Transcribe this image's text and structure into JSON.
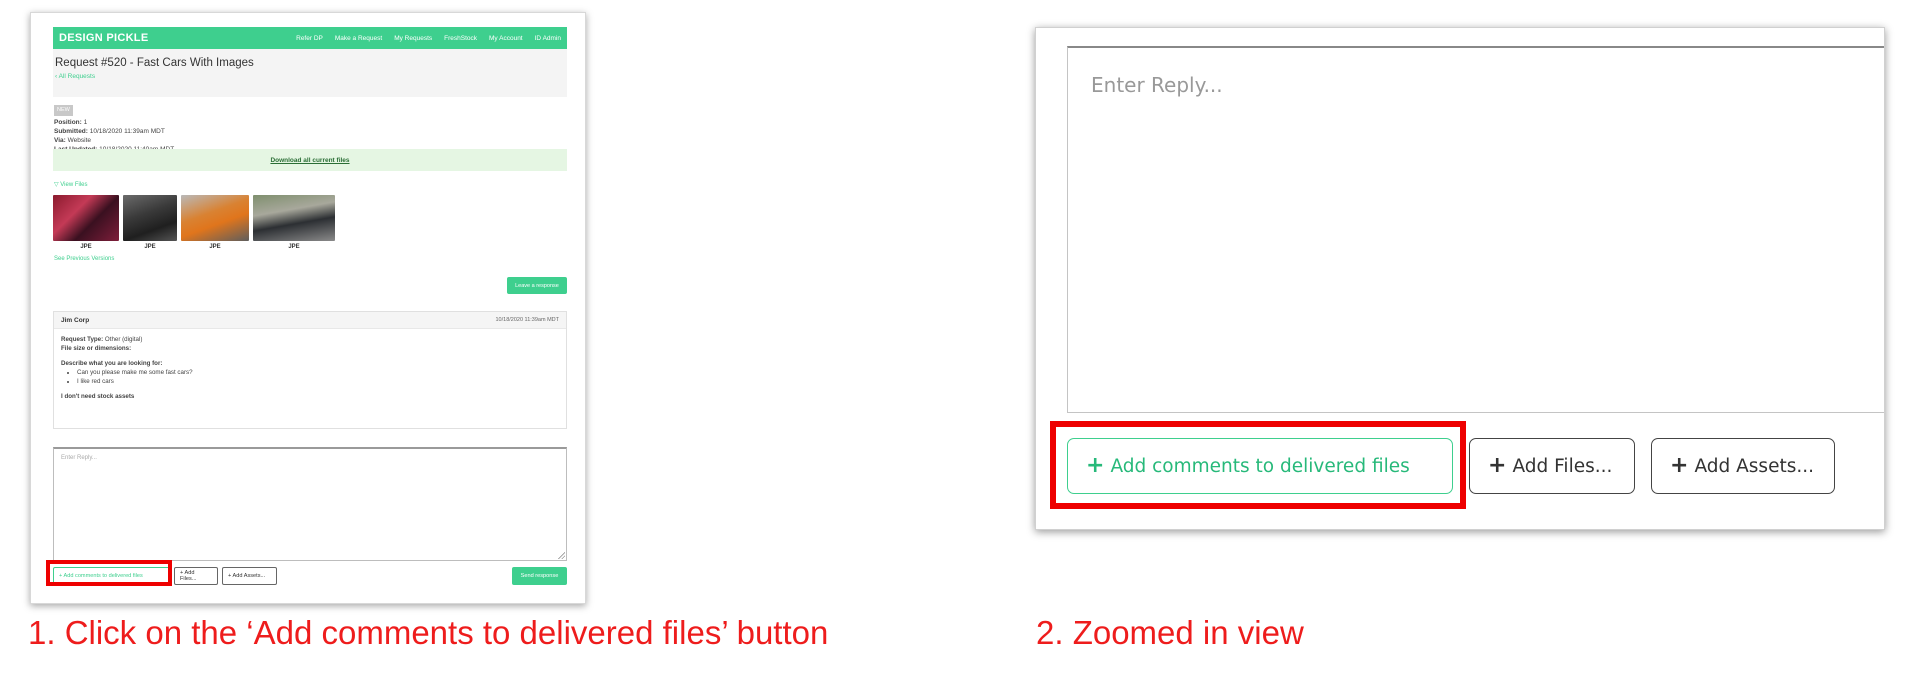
{
  "app": {
    "brand": "DESIGN PICKLE",
    "nav": [
      "Refer DP",
      "Make a Request",
      "My Requests",
      "FreshStock",
      "My Account",
      "ID Admin"
    ]
  },
  "request": {
    "title": "Request #520 - Fast Cars With Images",
    "back_link": "‹ All Requests",
    "status_chip": "NEW",
    "position_label": "Position:",
    "position_value": "1",
    "submitted_label": "Submitted:",
    "submitted_value": "10/18/2020 11:39am MDT",
    "via_label": "Via:",
    "via_value": "Website",
    "updated_label": "Last Updated:",
    "updated_value": "10/18/2020 11:40am MDT",
    "download_link": "Download all current files",
    "view_files": "▽ View Files",
    "thumbnails": [
      {
        "type": "JPE",
        "image": "red-car-image"
      },
      {
        "type": "JPE",
        "image": "dark-sports-car-image"
      },
      {
        "type": "JPE",
        "image": "orange-sports-car-image"
      },
      {
        "type": "JPE",
        "image": "black-sedan-image"
      }
    ],
    "previous_versions": "See Previous Versions",
    "leave_response": "Leave a response"
  },
  "message": {
    "author": "Jim Corp",
    "timestamp": "10/18/2020 11:39am MDT",
    "request_type_label": "Request Type:",
    "request_type_value": "Other (digital)",
    "file_size_label": "File size or dimensions:",
    "describe_label": "Describe what you are looking for:",
    "bullets": [
      "Can you please make me some fast cars?",
      "I like red cars"
    ],
    "stock_note": "I don't need stock assets"
  },
  "reply": {
    "placeholder_small": "Enter Reply...",
    "placeholder_large": "Enter Reply...",
    "add_comments_small": "+ Add comments to delivered files",
    "add_files_small": "+ Add Files...",
    "add_assets_small": "+ Add Assets...",
    "send_response": "Send response",
    "add_comments_large": "Add comments to delivered files",
    "add_files_large": "Add Files...",
    "add_assets_large": "Add Assets..."
  },
  "captions": {
    "step1": "1. Click on the ‘Add comments to delivered files’ button",
    "step2": "2. Zoomed in view"
  },
  "colors": {
    "brand_green": "#3ecf8e",
    "highlight_red": "#ee0000",
    "caption_red": "#ee1c1c"
  }
}
